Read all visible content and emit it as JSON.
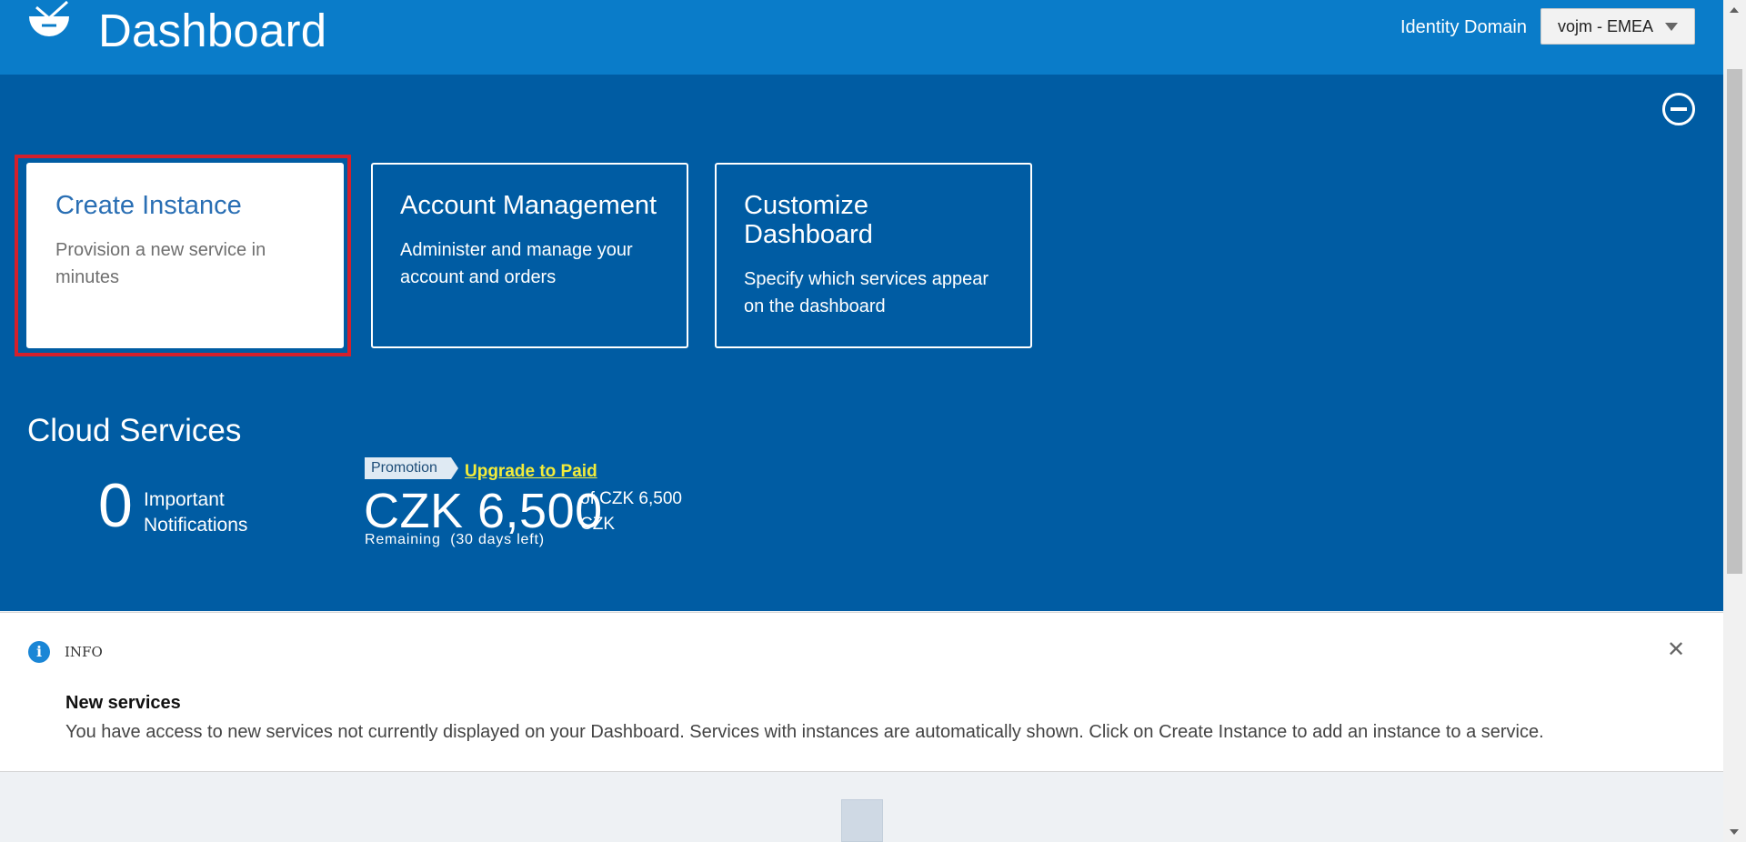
{
  "header": {
    "title": "Dashboard",
    "identity_domain_label": "Identity Domain",
    "identity_domain_value": "vojm - EMEA",
    "logo_icon": "cloud-logo-icon"
  },
  "cards": [
    {
      "title": "Create Instance",
      "description": "Provision a new service in minutes",
      "highlighted": true
    },
    {
      "title": "Account Management",
      "description": "Administer and manage your account and orders"
    },
    {
      "title": "Customize Dashboard",
      "description": "Specify which services appear on the dashboard"
    }
  ],
  "cloud_services": {
    "title": "Cloud Services",
    "notifications_count": "0",
    "notifications_label": "Important Notifications",
    "promotion_tag": "Promotion",
    "upgrade_link": "Upgrade to Paid",
    "credit_amount": "CZK 6,500",
    "credit_of": "of CZK 6,500 CZK",
    "remaining_label": "Remaining",
    "days_left": "(30 days left)"
  },
  "info": {
    "kind": "INFO",
    "heading": "New services",
    "body": "You have access to new services not currently displayed on your Dashboard. Services with instances are automatically shown. Click on Create Instance to add an instance to a service."
  },
  "colors": {
    "header": "#0a7cc9",
    "band": "#005ca3",
    "highlight": "#d4202c",
    "upgrade_link": "#f3ec3a"
  }
}
